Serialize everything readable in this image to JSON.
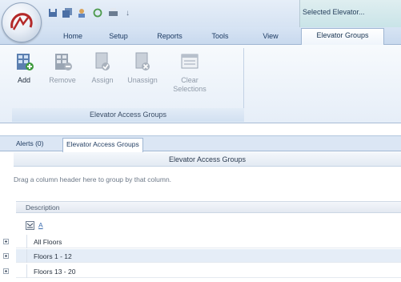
{
  "quick_access": {
    "icons": [
      "save-icon",
      "save-all-icon",
      "users-icon",
      "refresh-icon",
      "print-icon"
    ],
    "overflow": "↓"
  },
  "context": {
    "title": "Selected Elevator..."
  },
  "tabs": [
    {
      "label": "Home"
    },
    {
      "label": "Setup"
    },
    {
      "label": "Reports"
    },
    {
      "label": "Tools"
    },
    {
      "label": "View"
    },
    {
      "label": "Elevator Groups"
    }
  ],
  "ribbon": {
    "group_label": "Elevator Access Groups",
    "buttons": [
      {
        "label": "Add",
        "icon": "add-elevator-group-icon",
        "enabled": true
      },
      {
        "label": "Remove",
        "icon": "remove-elevator-group-icon",
        "enabled": false
      },
      {
        "label": "Assign",
        "icon": "assign-icon",
        "enabled": false
      },
      {
        "label": "Unassign",
        "icon": "unassign-icon",
        "enabled": false
      },
      {
        "label": "Clear Selections",
        "icon": "clear-selections-icon",
        "enabled": false
      }
    ]
  },
  "doc_tabs": [
    {
      "label": "Alerts (0)"
    },
    {
      "label": "Elevator Access Groups"
    }
  ],
  "grid": {
    "caption": "Elevator Access Groups",
    "group_hint": "Drag a column header here to group by that column.",
    "column": "Description",
    "filter_value": "A",
    "rows": [
      "All Floors",
      "Floors 1 - 12",
      "Floors 13 - 20"
    ]
  },
  "colors": {
    "ribbon_bg": "#e6eef8",
    "tab_bar": "#c8d9ee",
    "context_tab": "#c9e4e8",
    "row_alt": "#e5edf7"
  }
}
